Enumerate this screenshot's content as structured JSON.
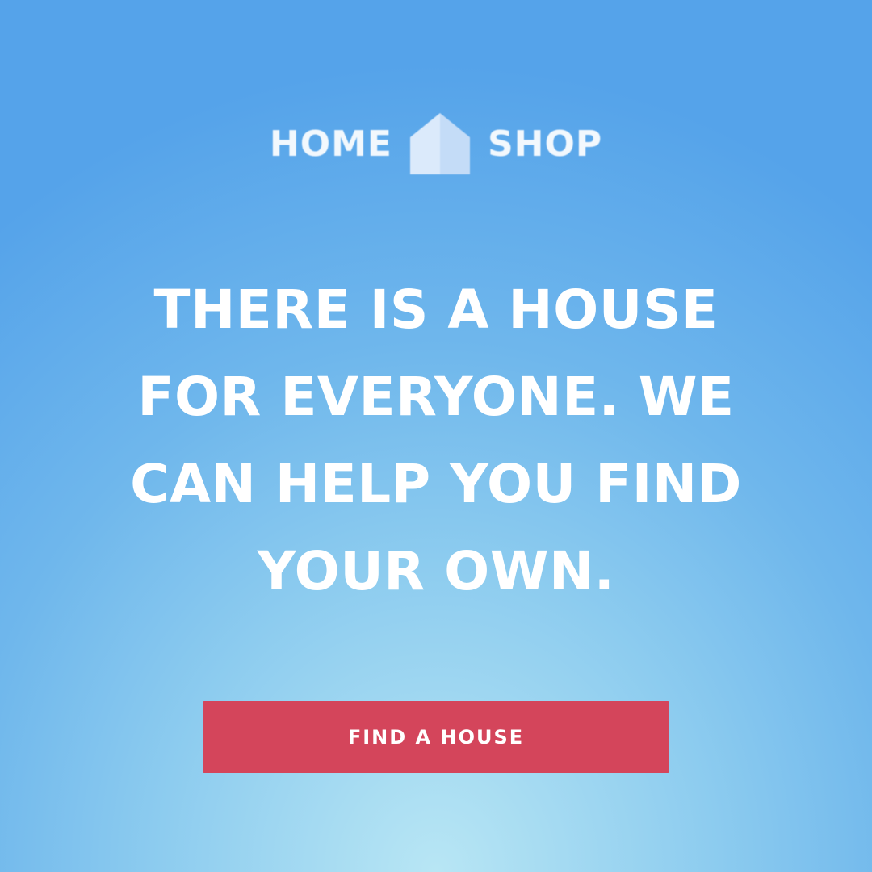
{
  "logo": {
    "left_word": "HOME",
    "right_word": "SHOP",
    "icon": "house-icon"
  },
  "headline": "THERE IS A HOUSE FOR EVERYONE. WE CAN HELP YOU FIND YOUR OWN.",
  "cta": {
    "label": "FIND A HOUSE"
  },
  "colors": {
    "background_top": "#55a3ea",
    "background_bottom": "#b8e6f4",
    "button": "#d4455b",
    "text": "#ffffff",
    "logo_house_light": "#dbeafb",
    "logo_house_dark": "#bcd7f6"
  }
}
